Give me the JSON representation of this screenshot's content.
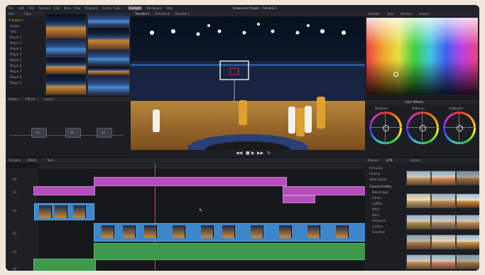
{
  "window": {
    "title": "Unbenannt Projekt - Timeline 1"
  },
  "menus": [
    "File",
    "Edit",
    "Trim",
    "Timeline",
    "Clip",
    "Mark",
    "View",
    "Playback",
    "Fusion",
    "Color",
    "Fairlight",
    "Workspace",
    "Help"
  ],
  "viewer_tabs": [
    "Timeline 1",
    "Timeline 2",
    "Timeline 3"
  ],
  "scopes_tabs": [
    "Qualifier",
    "Keys",
    "Window",
    "Scopes"
  ],
  "media_pool": {
    "tabs": [
      "Files",
      "Clips"
    ],
    "items": [
      "Timeline 1",
      "Angles",
      "Tiles",
      "Player 1",
      "Player 2",
      "Player 3",
      "Player 4",
      "Player 5",
      "Player 6",
      "Player 7",
      "Player 8",
      "Player 9"
    ]
  },
  "nodes": {
    "tabs": [
      "Nodes",
      "Effects",
      "Layers"
    ],
    "items": [
      "01",
      "02",
      "03"
    ]
  },
  "color_wheels": {
    "title": "Color Wheels",
    "wheels": [
      "Shadows",
      "Midtones",
      "Highlights"
    ]
  },
  "timeline": {
    "tabs": [
      "Timeline",
      "Effects",
      "Tools"
    ],
    "tracks": [
      "V4",
      "V3",
      "V2",
      "V1",
      "A1",
      "A2"
    ]
  },
  "lut_panel": {
    "tabs": [
      "Browse",
      "LUTs",
      "Library"
    ],
    "items": [
      "Film Look",
      "Cinema",
      "Wide Gamut",
      "Camera Profiles",
      "Blackmagic",
      "Canon",
      "Fujifilm",
      "Nikon",
      "Sony",
      "Panasonic",
      "Custom",
      "Favorites"
    ]
  },
  "colors": {
    "accent": "#e0a03a",
    "video_track": "#3d86c9",
    "audio_track": "#3d9a4d",
    "adjustment_clip": "#b24fb8"
  },
  "icons": [
    "play-icon",
    "stop-icon",
    "rewind-icon",
    "fast-forward-icon",
    "loop-icon",
    "cursor-icon"
  ]
}
